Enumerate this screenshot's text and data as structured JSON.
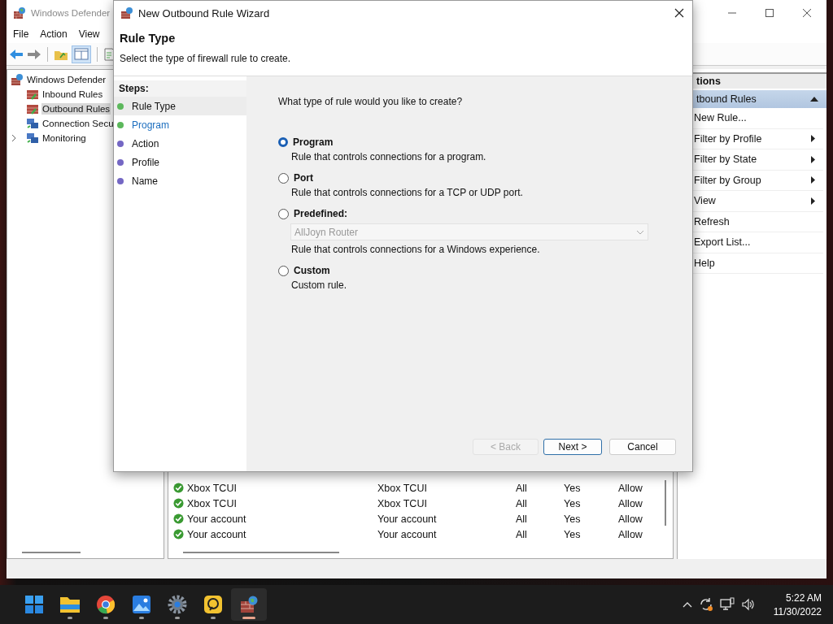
{
  "mmc": {
    "title": "Windows Defender",
    "menu": [
      "File",
      "Action",
      "View"
    ],
    "tree": {
      "label": "Windows Defender",
      "children": [
        {
          "label": "Inbound Rules",
          "selected": false,
          "expander": false
        },
        {
          "label": "Outbound Rules",
          "selected": true,
          "expander": false
        },
        {
          "label": "Connection Secu",
          "selected": false,
          "expander": false
        },
        {
          "label": "Monitoring",
          "selected": false,
          "expander": true
        }
      ]
    },
    "rules": [
      {
        "enabled": true,
        "cells": [
          "Xbox TCUI",
          "Xbox TCUI",
          "All",
          "Yes",
          "Allow"
        ]
      },
      {
        "enabled": true,
        "cells": [
          "Xbox TCUI",
          "Xbox TCUI",
          "All",
          "Yes",
          "Allow"
        ]
      },
      {
        "enabled": true,
        "cells": [
          "Your account",
          "Your account",
          "All",
          "Yes",
          "Allow"
        ]
      },
      {
        "enabled": true,
        "cells": [
          "Your account",
          "Your account",
          "All",
          "Yes",
          "Allow"
        ]
      }
    ],
    "actions": {
      "header": "tions",
      "group": "tbound Rules",
      "items": [
        {
          "label": "New Rule...",
          "submenu": false
        },
        {
          "label": "Filter by Profile",
          "submenu": true
        },
        {
          "label": "Filter by State",
          "submenu": true
        },
        {
          "label": "Filter by Group",
          "submenu": true
        },
        {
          "label": "View",
          "submenu": true
        },
        {
          "label": "Refresh",
          "submenu": false
        },
        {
          "label": "Export List...",
          "submenu": false
        },
        {
          "label": "Help",
          "submenu": false
        }
      ]
    }
  },
  "wizard": {
    "title": "New Outbound Rule Wizard",
    "heading": "Rule Type",
    "subtitle": "Select the type of firewall rule to create.",
    "steps_label": "Steps:",
    "steps": [
      {
        "label": "Rule Type",
        "selected": true,
        "link": false,
        "color": "#5cb85c"
      },
      {
        "label": "Program",
        "selected": false,
        "link": true,
        "color": "#5cb85c"
      },
      {
        "label": "Action",
        "selected": false,
        "link": false,
        "color": "#7467c4"
      },
      {
        "label": "Profile",
        "selected": false,
        "link": false,
        "color": "#7467c4"
      },
      {
        "label": "Name",
        "selected": false,
        "link": false,
        "color": "#7467c4"
      }
    ],
    "question": "What type of rule would you like to create?",
    "options": [
      {
        "label": "Program",
        "selected": true,
        "description": "Rule that controls connections for a program."
      },
      {
        "label": "Port",
        "selected": false,
        "description": "Rule that controls connections for a TCP or UDP port."
      },
      {
        "label": "Predefined:",
        "selected": false,
        "dropdown": {
          "value": "AllJoyn Router",
          "disabled": true
        },
        "description": "Rule that controls connections for a Windows experience."
      },
      {
        "label": "Custom",
        "selected": false,
        "description": "Custom rule."
      }
    ],
    "buttons": [
      {
        "label": "< Back",
        "disabled": true,
        "default": false
      },
      {
        "label": "Next >",
        "disabled": false,
        "default": true
      },
      {
        "label": "Cancel",
        "disabled": false,
        "default": false
      }
    ]
  },
  "taskbar": {
    "apps": [
      {
        "kind": "start",
        "running": false,
        "active": false
      },
      {
        "kind": "explorer",
        "running": true,
        "active": false
      },
      {
        "kind": "chrome",
        "running": true,
        "active": false
      },
      {
        "kind": "photos",
        "running": true,
        "active": false
      },
      {
        "kind": "settings",
        "running": true,
        "active": false
      },
      {
        "kind": "remote",
        "running": true,
        "active": false
      },
      {
        "kind": "firewall",
        "running": true,
        "active": true
      }
    ],
    "time": "5:22 AM",
    "date": "11/30/2022"
  }
}
